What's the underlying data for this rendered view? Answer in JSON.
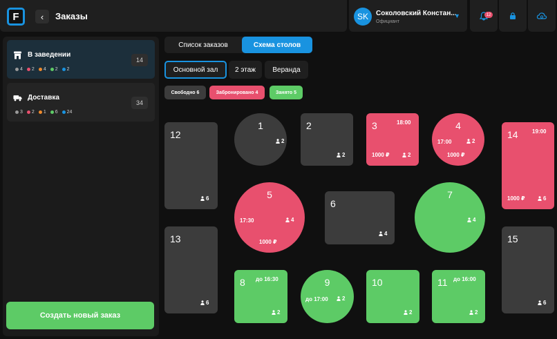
{
  "app": {
    "logo_letter": "F",
    "title": "Заказы"
  },
  "user": {
    "initials": "SK",
    "name": "Соколовский Констан...",
    "role": "Официант"
  },
  "notifications": {
    "count": "12"
  },
  "sidebar": {
    "cards": [
      {
        "title": "В заведении",
        "count": "14",
        "icon": "store-icon",
        "stats": [
          {
            "color": "#9a9a9a",
            "value": "4"
          },
          {
            "color": "#e8506e",
            "value": "2"
          },
          {
            "color": "#f08a2c",
            "value": "4"
          },
          {
            "color": "#5dcb66",
            "value": "2"
          },
          {
            "color": "#1993e0",
            "value": "2"
          }
        ]
      },
      {
        "title": "Доставка",
        "count": "34",
        "icon": "truck-icon",
        "stats": [
          {
            "color": "#9a9a9a",
            "value": "3"
          },
          {
            "color": "#e8506e",
            "value": "2"
          },
          {
            "color": "#f08a2c",
            "value": "1"
          },
          {
            "color": "#5dcb66",
            "value": "6"
          },
          {
            "color": "#1993e0",
            "value": "24"
          }
        ]
      }
    ],
    "create_label": "Создать новый заказ"
  },
  "view_tabs": [
    "Список заказов",
    "Схема столов"
  ],
  "halls": [
    "Основной зал",
    "2 этаж",
    "Веранда"
  ],
  "legend": {
    "free": "Свободно 6",
    "booked": "Забронировано 4",
    "occupied": "Занято 5"
  },
  "colors": {
    "accent": "#1993e0",
    "free": "#3c3c3c",
    "booked": "#e8506e",
    "occupied": "#5dcb66"
  },
  "tables": [
    {
      "num": "1",
      "seats": "2",
      "status": "free",
      "time": "",
      "price": ""
    },
    {
      "num": "2",
      "seats": "2",
      "status": "free",
      "time": "",
      "price": ""
    },
    {
      "num": "3",
      "seats": "2",
      "status": "booked",
      "time": "18:00",
      "price": "1000 ₽"
    },
    {
      "num": "4",
      "seats": "2",
      "status": "booked",
      "time": "17:00",
      "price": "1000 ₽"
    },
    {
      "num": "5",
      "seats": "4",
      "status": "booked",
      "time": "17:30",
      "price": "1000 ₽"
    },
    {
      "num": "6",
      "seats": "4",
      "status": "free",
      "time": "",
      "price": ""
    },
    {
      "num": "7",
      "seats": "4",
      "status": "occupied",
      "time": "",
      "price": ""
    },
    {
      "num": "8",
      "seats": "2",
      "status": "occupied",
      "time": "до 16:30",
      "price": ""
    },
    {
      "num": "9",
      "seats": "2",
      "status": "occupied",
      "time": "до 17:00",
      "price": ""
    },
    {
      "num": "10",
      "seats": "2",
      "status": "occupied",
      "time": "",
      "price": ""
    },
    {
      "num": "11",
      "seats": "2",
      "status": "occupied",
      "time": "до 16:00",
      "price": ""
    },
    {
      "num": "12",
      "seats": "6",
      "status": "free",
      "time": "",
      "price": ""
    },
    {
      "num": "13",
      "seats": "6",
      "status": "free",
      "time": "",
      "price": ""
    },
    {
      "num": "14",
      "seats": "6",
      "status": "booked",
      "time": "19:00",
      "price": "1000 ₽"
    },
    {
      "num": "15",
      "seats": "6",
      "status": "free",
      "time": "",
      "price": ""
    }
  ]
}
